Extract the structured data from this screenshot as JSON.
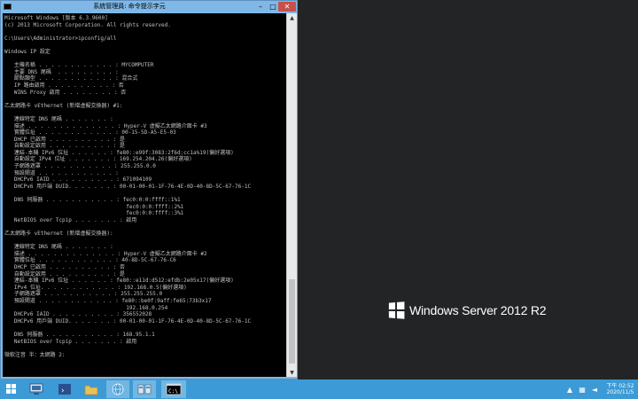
{
  "window": {
    "title": "系統管理員: 命令提示字元",
    "minimize": "–",
    "maximize": "□",
    "close": "✕"
  },
  "console": {
    "lines": [
      "Microsoft Windows [版本 6.3.9600]",
      "(c) 2013 Microsoft Corporation. All rights reserved.",
      "",
      "C:\\Users\\Administrator>ipconfig/all",
      "",
      "Windows IP 設定",
      "",
      "   主機名稱 . . . . . . . . . . . . : MYCOMPUTER",
      "   主要 DNS 尾碼  . . . . . . . . . :",
      "   節點類型 . . . . . . . . . . . . : 混合式",
      "   IP 路由啟用 . . . . . . . . . . : 否",
      "   WINS Proxy 啟用 . . . . . . . . : 否",
      "",
      "乙太網路卡 vEthernet (新增虛擬交換器) #1:",
      "",
      "   連線特定 DNS 尾碼 . . . . . . . :",
      "   描述 . . . . . . . . . . . . . . : Hyper-V 虛擬乙太網路介面卡 #3",
      "   實體位址 . . . . . . . . . . . . : 00-15-5D-A5-E5-03",
      "   DHCP 已啟用 . . . . . . . . . . : 是",
      "   自動設定啟用 . . . . . . . . . . : 是",
      "   連結-本機 IPv6 位址 . . . . . . : fe80::e99f:3083:2f6d:cc1a%19(偏好選項)",
      "   自動設定 IPv4 位址 . . . . . . . : 169.254.204.26(偏好選項)",
      "   子網路遮罩 . . . . . . . . . . . : 255.255.0.0",
      "   預設閘道 . . . . . . . . . . . . :",
      "   DHCPv6 IAID . . . . . . . . . . : 671094109",
      "   DHCPv6 用戶端 DUID. . . . . . . : 00-01-00-01-1F-76-4E-0D-40-8D-5C-67-76-1C",
      "",
      "   DNS 伺服器 . . . . . . . . . . . : fec0:0:0:ffff::1%1",
      "                                      fec0:0:0:ffff::2%1",
      "                                      fec0:0:0:ffff::3%1",
      "   NetBIOS over Tcpip . . . . . . . : 啟用",
      "",
      "乙太網路卡 vEthernet (新增虛擬交換器):",
      "",
      "   連線特定 DNS 尾碼 . . . . . . . :",
      "   描述 . . . . . . . . . . . . . . : Hyper-V 虛擬乙太網路介面卡 #2",
      "   實體位址 . . . . . . . . . . . . : 40-8D-5C-67-76-C6",
      "   DHCP 已啟用 . . . . . . . . . . : 否",
      "   自動設定啟用 . . . . . . . . . . : 是",
      "   連結-本機 IPv6 位址 . . . . . . : fe80::e11d:d512:efdb:2e05x17(偏好選項)",
      "   IPv4 位址. . . . . . . . . . . . : 192.168.0.5(偏好選項)",
      "   子網路遮罩 . . . . . . . . . . . : 255.255.255.0",
      "   預設閘道 . . . . . . . . . . . . : fe80::be0f:9aff:fe65:73b3x17",
      "                                      192.168.0.254",
      "   DHCPv6 IAID . . . . . . . . . . : 356552028",
      "   DHCPv6 用戶端 DUID. . . . . . . : 00-01-00-01-1F-76-4E-0D-40-8D-5C-67-76-1C",
      "",
      "   DNS 伺服器 . . . . . . . . . . . : 168.95.1.1",
      "   NetBIOS over Tcpip . . . . . . . : 啟用",
      "",
      "微軟注音 半：太網路 2:"
    ]
  },
  "desktop": {
    "logo_text": "Windows Server 2012 R2"
  },
  "taskbar": {
    "items": [
      {
        "name": "start",
        "icon": "windows-flag-icon"
      },
      {
        "name": "server-manager",
        "icon": "server-manager-icon",
        "color": "#3a6ea5"
      },
      {
        "name": "powershell",
        "icon": "powershell-icon",
        "color": "#2a4f8c"
      },
      {
        "name": "file-explorer",
        "icon": "folder-icon",
        "color": "#e8c15a"
      },
      {
        "name": "network",
        "icon": "network-globe-icon",
        "color": "#4aa0d8"
      },
      {
        "name": "hyper-v-manager",
        "icon": "hyper-v-icon",
        "color": "#6a8fb0"
      },
      {
        "name": "command-prompt",
        "icon": "cmd-icon",
        "color": "#000000"
      }
    ],
    "clock_time": "下午 02:52",
    "clock_date": "2020/11/5"
  },
  "colors": {
    "titlebar": "#7fb8e6",
    "taskbar": "#3c9ad6",
    "console_bg": "#000000",
    "console_fg": "#c0c0c0",
    "desktop_bg": "#222426",
    "close_button": "#c7504b"
  }
}
